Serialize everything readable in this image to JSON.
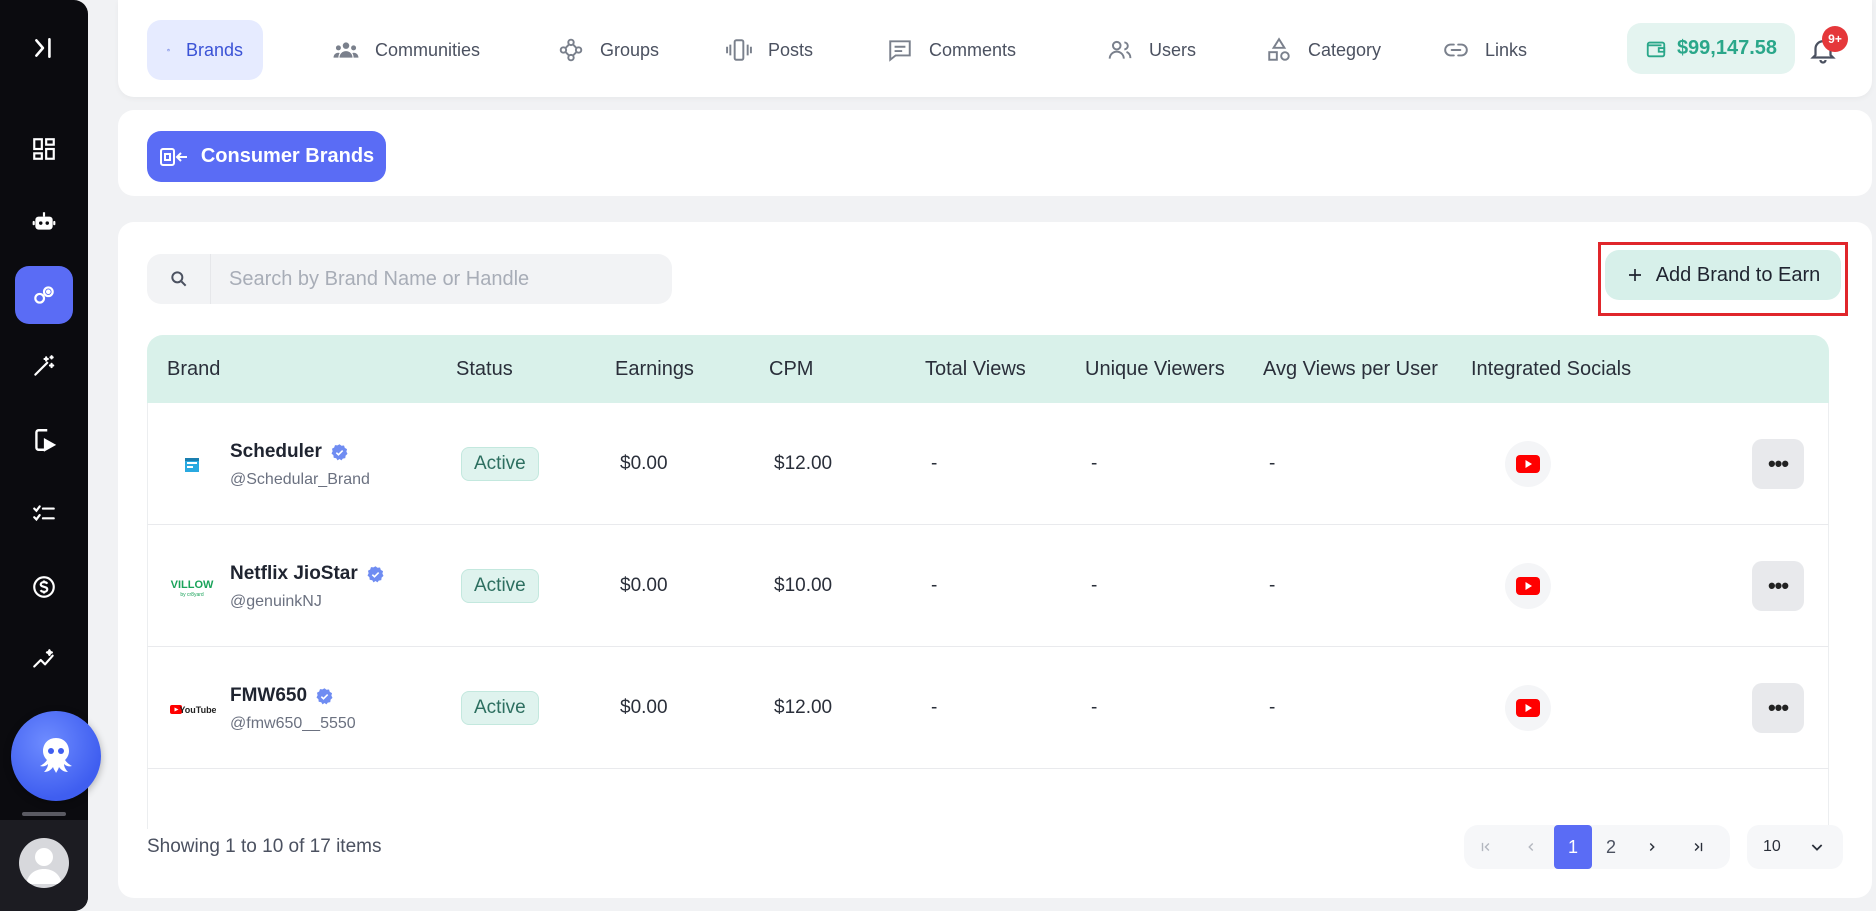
{
  "nav": {
    "items": [
      {
        "label": "Brands",
        "icon": "briefcase-icon",
        "active": true
      },
      {
        "label": "Communities",
        "icon": "people-group-icon"
      },
      {
        "label": "Groups",
        "icon": "groups-diamond-icon"
      },
      {
        "label": "Posts",
        "icon": "vibrate-phone-icon"
      },
      {
        "label": "Comments",
        "icon": "comment-icon"
      },
      {
        "label": "Users",
        "icon": "users-icon"
      },
      {
        "label": "Category",
        "icon": "shapes-icon"
      },
      {
        "label": "Links",
        "icon": "link-icon"
      }
    ],
    "wallet_amount": "$99,147.58",
    "notification_badge": "9+"
  },
  "filter": {
    "consumer_brands_label": "Consumer Brands"
  },
  "search": {
    "placeholder": "Search by Brand Name or Handle"
  },
  "actions": {
    "add_brand_label": "Add Brand to Earn"
  },
  "table": {
    "columns": [
      "Brand",
      "Status",
      "Earnings",
      "CPM",
      "Total Views",
      "Unique Viewers",
      "Avg Views per User",
      "Integrated Socials"
    ],
    "rows": [
      {
        "name": "Scheduler",
        "handle": "@Schedular_Brand",
        "status": "Active",
        "earnings": "$0.00",
        "cpm": "$12.00",
        "total_views": "-",
        "unique_viewers": "-",
        "avg_views": "-",
        "social": "youtube-icon"
      },
      {
        "name": "Netflix JioStar",
        "handle": "@genuinkNJ",
        "status": "Active",
        "earnings": "$0.00",
        "cpm": "$10.00",
        "total_views": "-",
        "unique_viewers": "-",
        "avg_views": "-",
        "social": "youtube-icon"
      },
      {
        "name": "FMW650",
        "handle": "@fmw650__5550",
        "status": "Active",
        "earnings": "$0.00",
        "cpm": "$12.00",
        "total_views": "-",
        "unique_viewers": "-",
        "avg_views": "-",
        "social": "youtube-icon"
      }
    ]
  },
  "pagination": {
    "summary": "Showing 1 to 10 of 17 items",
    "pages": [
      "1",
      "2"
    ],
    "current_page": "1",
    "page_size": "10"
  },
  "logos": {
    "row2_text": "VILLOW",
    "row2_sub": "by cr8yard",
    "row3_text": "YouTube"
  },
  "colors": {
    "accent": "#5a6cf5",
    "sidebar": "#0b0b0f",
    "header_row": "#d9f1ea",
    "wallet": "#2aa78a",
    "youtube": "#ff0000",
    "highlight_frame": "#e0262b"
  }
}
